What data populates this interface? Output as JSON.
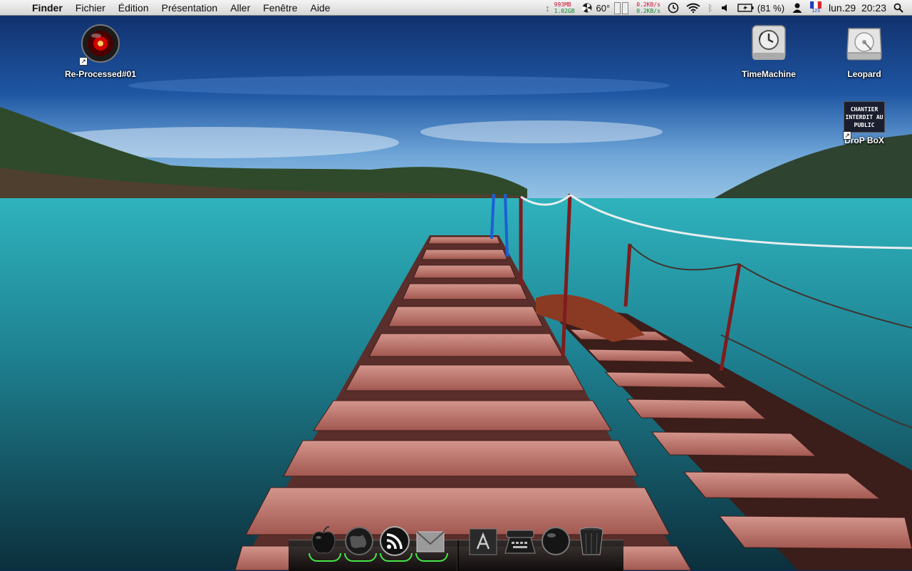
{
  "menubar": {
    "apple_glyph": "",
    "app_name": "Finder",
    "menus": [
      "Fichier",
      "Édition",
      "Présentation",
      "Aller",
      "Fenêtre",
      "Aide"
    ],
    "status": {
      "mem_used": "993MB",
      "mem_free": "1.02GB",
      "temperature": "60°",
      "net_up": "0.2KB/s",
      "net_down": "0.2KB/s",
      "battery": "(81 %)",
      "input_source_num": "123",
      "clock": "lun.29  20:23"
    }
  },
  "desktop": {
    "icons": [
      {
        "label": "Re-Processed#01",
        "icon": "hal-eye-icon"
      },
      {
        "label": "TimeMachine",
        "icon": "time-machine-drive-icon"
      },
      {
        "label": "Leopard",
        "icon": "hard-drive-icon"
      },
      {
        "label": "DroP BoX",
        "icon": "chantier-sign-icon",
        "sign_text": "CHANTIER INTERDIT AU PUBLIC"
      }
    ]
  },
  "dock": {
    "left_items": [
      "finder-apple-icon",
      "globe-icon",
      "rss-icon",
      "mail-icon"
    ],
    "right_items": [
      "applications-folder-icon",
      "typewriter-icon",
      "sphere-icon",
      "trash-icon"
    ]
  },
  "colors": {
    "menubar_bg": "#e6e6e6",
    "sky": "#1d4f93",
    "sea": "#2aa7b1",
    "pier": "#b56a62",
    "dock_glow": "#45e84a"
  }
}
